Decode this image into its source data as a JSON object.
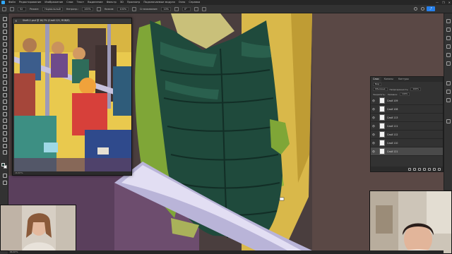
{
  "app": {
    "menu_items": [
      "Файл",
      "Редактирование",
      "Изображение",
      "Слои",
      "Текст",
      "Выделение",
      "Фильтр",
      "3D",
      "Просмотр",
      "Подключаемые модули",
      "Окно",
      "Справка"
    ],
    "window_controls": [
      "—",
      "❐",
      "✕"
    ]
  },
  "options_bar": {
    "mode_label": "Режим:",
    "mode_value": "Нормальный",
    "opacity_label": "Непрозр.:",
    "opacity_value": "100%",
    "flow_label": "Нажим:",
    "flow_value": "100%",
    "smoothing_label": "Сглаживание:",
    "smoothing_value": "10%",
    "brush_size": "52",
    "angle_value": "0°"
  },
  "nav_window": {
    "title": "Sheft-1.psd @ 16,7% (Слой 121, RGB/8)",
    "footer": "16,67%"
  },
  "layers_panel": {
    "tabs": [
      "Слои",
      "Каналы",
      "Контуры"
    ],
    "search_kind": "Вид",
    "blend_mode": "Обычные",
    "opacity_label": "Непрозрачность:",
    "opacity_value": "100%",
    "lock_label": "Закрепить:",
    "fill_label": "Заливка:",
    "fill_value": "100%",
    "layers": [
      {
        "name": "Слой 109",
        "selected": false
      },
      {
        "name": "Слой 108",
        "selected": false
      },
      {
        "name": "Слой 113",
        "selected": false
      },
      {
        "name": "Слой 111",
        "selected": false
      },
      {
        "name": "Слой 112",
        "selected": false
      },
      {
        "name": "Слой 110",
        "selected": false
      },
      {
        "name": "Слой 121",
        "selected": true
      }
    ]
  },
  "status": {
    "zoom": "66,67%"
  },
  "colors": {
    "accent": "#2680eb",
    "foreground_swatch": "#1d3b34",
    "background_swatch": "#ffffff"
  }
}
